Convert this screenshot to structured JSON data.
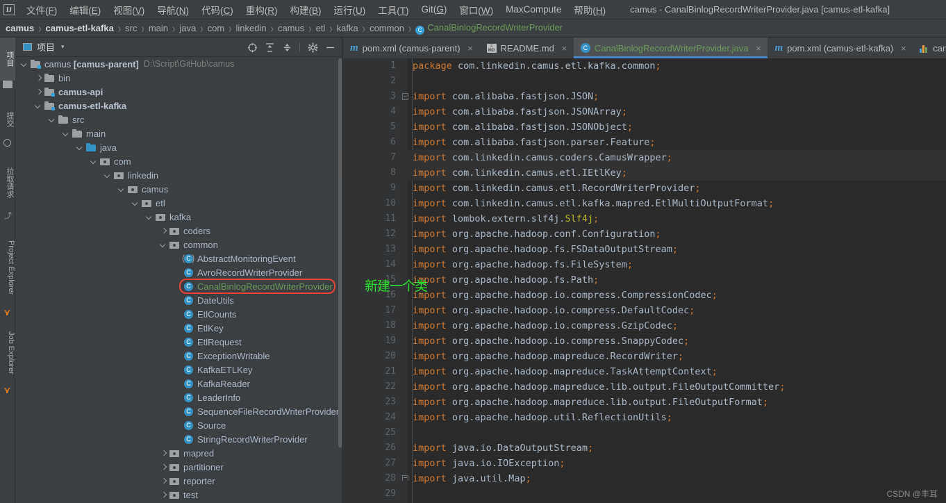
{
  "window": {
    "title": "camus - CanalBinlogRecordWriterProvider.java [camus-etl-kafka]",
    "logo": "IJ"
  },
  "menubar": {
    "items": [
      {
        "label": "文件(F)",
        "mnemonic": "F"
      },
      {
        "label": "编辑(E)",
        "mnemonic": "E"
      },
      {
        "label": "视图(V)",
        "mnemonic": "V"
      },
      {
        "label": "导航(N)",
        "mnemonic": "N"
      },
      {
        "label": "代码(C)",
        "mnemonic": "C"
      },
      {
        "label": "重构(R)",
        "mnemonic": "R"
      },
      {
        "label": "构建(B)",
        "mnemonic": "B"
      },
      {
        "label": "运行(U)",
        "mnemonic": "U"
      },
      {
        "label": "工具(T)",
        "mnemonic": "T"
      },
      {
        "label": "Git(G)",
        "mnemonic": "G"
      },
      {
        "label": "窗口(W)",
        "mnemonic": "W"
      },
      {
        "label": "MaxCompute",
        "mnemonic": ""
      },
      {
        "label": "帮助(H)",
        "mnemonic": "H"
      }
    ]
  },
  "breadcrumb": {
    "items": [
      {
        "label": "camus",
        "style": "bold"
      },
      {
        "label": "camus-etl-kafka",
        "style": "bold"
      },
      {
        "label": "src",
        "style": "normal"
      },
      {
        "label": "main",
        "style": "normal"
      },
      {
        "label": "java",
        "style": "normal"
      },
      {
        "label": "com",
        "style": "normal"
      },
      {
        "label": "linkedin",
        "style": "normal"
      },
      {
        "label": "camus",
        "style": "normal"
      },
      {
        "label": "etl",
        "style": "normal"
      },
      {
        "label": "kafka",
        "style": "normal"
      },
      {
        "label": "common",
        "style": "normal"
      }
    ],
    "current": "CanalBinlogRecordWriterProvider",
    "current_icon": "C",
    "separator": "›"
  },
  "toolstrip": {
    "items": [
      {
        "label": "项目",
        "icon": "project-icon",
        "active": true
      },
      {
        "label": "提交",
        "icon": "commit-icon",
        "active": false
      },
      {
        "label": "拉取请求",
        "icon": "pull-request-icon",
        "active": false
      },
      {
        "label": "Project Explorer",
        "icon": "maxcompute-icon",
        "active": false
      },
      {
        "label": "Job Explorer",
        "icon": "maxcompute-icon",
        "active": false
      }
    ]
  },
  "project_panel": {
    "title": "项目",
    "caret": "▾",
    "actions": [
      {
        "name": "select-opened-file",
        "glyph": "⊕"
      },
      {
        "name": "expand-all",
        "glyph": "⨍"
      },
      {
        "name": "collapse-all",
        "glyph": "⨌"
      },
      {
        "name": "settings",
        "glyph": "⚙"
      },
      {
        "name": "hide",
        "glyph": "—"
      }
    ],
    "tree": [
      {
        "indent": 0,
        "arrow": "down",
        "icon": "module-folder",
        "label": "camus [camus-parent]",
        "bold": true,
        "path": "D:\\Script\\GitHub\\camus"
      },
      {
        "indent": 1,
        "arrow": "right",
        "icon": "folder",
        "label": "bin",
        "bold": false,
        "path": ""
      },
      {
        "indent": 1,
        "arrow": "right",
        "icon": "module-folder",
        "label": "camus-api",
        "bold": true,
        "path": ""
      },
      {
        "indent": 1,
        "arrow": "down",
        "icon": "module-folder",
        "label": "camus-etl-kafka",
        "bold": true,
        "path": ""
      },
      {
        "indent": 2,
        "arrow": "down",
        "icon": "folder",
        "label": "src",
        "bold": false,
        "path": ""
      },
      {
        "indent": 3,
        "arrow": "down",
        "icon": "folder",
        "label": "main",
        "bold": false,
        "path": ""
      },
      {
        "indent": 4,
        "arrow": "down",
        "icon": "source-folder",
        "label": "java",
        "bold": false,
        "path": ""
      },
      {
        "indent": 5,
        "arrow": "down",
        "icon": "package",
        "label": "com",
        "bold": false,
        "path": ""
      },
      {
        "indent": 6,
        "arrow": "down",
        "icon": "package",
        "label": "linkedin",
        "bold": false,
        "path": ""
      },
      {
        "indent": 7,
        "arrow": "down",
        "icon": "package",
        "label": "camus",
        "bold": false,
        "path": ""
      },
      {
        "indent": 8,
        "arrow": "down",
        "icon": "package",
        "label": "etl",
        "bold": false,
        "path": ""
      },
      {
        "indent": 9,
        "arrow": "down",
        "icon": "package",
        "label": "kafka",
        "bold": false,
        "path": ""
      },
      {
        "indent": 10,
        "arrow": "right",
        "icon": "package",
        "label": "coders",
        "bold": false,
        "path": ""
      },
      {
        "indent": 10,
        "arrow": "down",
        "icon": "package",
        "label": "common",
        "bold": false,
        "path": ""
      },
      {
        "indent": 11,
        "arrow": "none",
        "icon": "interface",
        "label": "AbstractMonitoringEvent",
        "bold": false,
        "path": ""
      },
      {
        "indent": 11,
        "arrow": "none",
        "icon": "class",
        "label": "AvroRecordWriterProvider",
        "bold": false,
        "path": ""
      },
      {
        "indent": 11,
        "arrow": "none",
        "icon": "class",
        "label": "CanalBinlogRecordWriterProvider",
        "bold": false,
        "path": "",
        "highlighted": true
      },
      {
        "indent": 11,
        "arrow": "none",
        "icon": "class",
        "label": "DateUtils",
        "bold": false,
        "path": ""
      },
      {
        "indent": 11,
        "arrow": "none",
        "icon": "class",
        "label": "EtlCounts",
        "bold": false,
        "path": ""
      },
      {
        "indent": 11,
        "arrow": "none",
        "icon": "class",
        "label": "EtlKey",
        "bold": false,
        "path": ""
      },
      {
        "indent": 11,
        "arrow": "none",
        "icon": "class",
        "label": "EtlRequest",
        "bold": false,
        "path": ""
      },
      {
        "indent": 11,
        "arrow": "none",
        "icon": "class",
        "label": "ExceptionWritable",
        "bold": false,
        "path": ""
      },
      {
        "indent": 11,
        "arrow": "none",
        "icon": "class",
        "label": "KafkaETLKey",
        "bold": false,
        "path": ""
      },
      {
        "indent": 11,
        "arrow": "none",
        "icon": "class",
        "label": "KafkaReader",
        "bold": false,
        "path": ""
      },
      {
        "indent": 11,
        "arrow": "none",
        "icon": "class",
        "label": "LeaderInfo",
        "bold": false,
        "path": ""
      },
      {
        "indent": 11,
        "arrow": "none",
        "icon": "class",
        "label": "SequenceFileRecordWriterProvider",
        "bold": false,
        "path": ""
      },
      {
        "indent": 11,
        "arrow": "none",
        "icon": "class",
        "label": "Source",
        "bold": false,
        "path": ""
      },
      {
        "indent": 11,
        "arrow": "none",
        "icon": "class",
        "label": "StringRecordWriterProvider",
        "bold": false,
        "path": ""
      },
      {
        "indent": 10,
        "arrow": "right",
        "icon": "package",
        "label": "mapred",
        "bold": false,
        "path": ""
      },
      {
        "indent": 10,
        "arrow": "right",
        "icon": "package",
        "label": "partitioner",
        "bold": false,
        "path": ""
      },
      {
        "indent": 10,
        "arrow": "right",
        "icon": "package",
        "label": "reporter",
        "bold": false,
        "path": ""
      },
      {
        "indent": 10,
        "arrow": "right",
        "icon": "package",
        "label": "test",
        "bold": false,
        "path": ""
      }
    ]
  },
  "editor": {
    "tabs": [
      {
        "label": "pom.xml (camus-parent)",
        "icon": "maven-icon",
        "active": false,
        "close": "×"
      },
      {
        "label": "README.md",
        "icon": "markdown-icon",
        "active": false,
        "close": "×"
      },
      {
        "label": "CanalBinlogRecordWriterProvider.java",
        "icon": "class-icon",
        "active": true,
        "close": "×"
      },
      {
        "label": "pom.xml (camus-etl-kafka)",
        "icon": "maven-icon",
        "active": false,
        "close": "×"
      },
      {
        "label": "camus.",
        "icon": "chart-icon",
        "active": false,
        "close": ""
      }
    ],
    "lines": [
      {
        "n": 1,
        "kw": "package",
        "rest": " com.linkedin.camus.etl.kafka.common;",
        "fold": "",
        "hl": false
      },
      {
        "n": 2,
        "kw": "",
        "rest": "",
        "fold": "",
        "hl": false
      },
      {
        "n": 3,
        "kw": "import",
        "rest": " com.alibaba.fastjson.JSON;",
        "fold": "start",
        "hl": false
      },
      {
        "n": 4,
        "kw": "import",
        "rest": " com.alibaba.fastjson.JSONArray;",
        "fold": "",
        "hl": false
      },
      {
        "n": 5,
        "kw": "import",
        "rest": " com.alibaba.fastjson.JSONObject;",
        "fold": "",
        "hl": false
      },
      {
        "n": 6,
        "kw": "import",
        "rest": " com.alibaba.fastjson.parser.Feature;",
        "fold": "",
        "hl": false
      },
      {
        "n": 7,
        "kw": "import",
        "rest": " com.linkedin.camus.coders.CamusWrapper;",
        "fold": "",
        "hl": true
      },
      {
        "n": 8,
        "kw": "import",
        "rest": " com.linkedin.camus.etl.IEtlKey;",
        "fold": "",
        "hl": true
      },
      {
        "n": 9,
        "kw": "import",
        "rest": " com.linkedin.camus.etl.RecordWriterProvider;",
        "fold": "",
        "hl": false
      },
      {
        "n": 10,
        "kw": "import",
        "rest": " com.linkedin.camus.etl.kafka.mapred.EtlMultiOutputFormat;",
        "fold": "",
        "hl": false
      },
      {
        "n": 11,
        "kw": "import",
        "rest": " lombok.extern.slf4j.",
        "annotation": "Slf4j",
        "tail": ";",
        "fold": "",
        "hl": false
      },
      {
        "n": 12,
        "kw": "import",
        "rest": " org.apache.hadoop.conf.Configuration;",
        "fold": "",
        "hl": false
      },
      {
        "n": 13,
        "kw": "import",
        "rest": " org.apache.hadoop.fs.FSDataOutputStream;",
        "fold": "",
        "hl": false
      },
      {
        "n": 14,
        "kw": "import",
        "rest": " org.apache.hadoop.fs.FileSystem;",
        "fold": "",
        "hl": false
      },
      {
        "n": 15,
        "kw": "import",
        "rest": " org.apache.hadoop.fs.Path;",
        "fold": "",
        "hl": false
      },
      {
        "n": 16,
        "kw": "import",
        "rest": " org.apache.hadoop.io.compress.CompressionCodec;",
        "fold": "",
        "hl": false
      },
      {
        "n": 17,
        "kw": "import",
        "rest": " org.apache.hadoop.io.compress.DefaultCodec;",
        "fold": "",
        "hl": false
      },
      {
        "n": 18,
        "kw": "import",
        "rest": " org.apache.hadoop.io.compress.GzipCodec;",
        "fold": "",
        "hl": false
      },
      {
        "n": 19,
        "kw": "import",
        "rest": " org.apache.hadoop.io.compress.SnappyCodec;",
        "fold": "",
        "hl": false
      },
      {
        "n": 20,
        "kw": "import",
        "rest": " org.apache.hadoop.mapreduce.RecordWriter;",
        "fold": "",
        "hl": false
      },
      {
        "n": 21,
        "kw": "import",
        "rest": " org.apache.hadoop.mapreduce.TaskAttemptContext;",
        "fold": "",
        "hl": false
      },
      {
        "n": 22,
        "kw": "import",
        "rest": " org.apache.hadoop.mapreduce.lib.output.FileOutputCommitter;",
        "fold": "",
        "hl": false
      },
      {
        "n": 23,
        "kw": "import",
        "rest": " org.apache.hadoop.mapreduce.lib.output.FileOutputFormat;",
        "fold": "",
        "hl": false
      },
      {
        "n": 24,
        "kw": "import",
        "rest": " org.apache.hadoop.util.ReflectionUtils;",
        "fold": "",
        "hl": false
      },
      {
        "n": 25,
        "kw": "",
        "rest": "",
        "fold": "",
        "hl": false
      },
      {
        "n": 26,
        "kw": "import",
        "rest": " java.io.DataOutputStream;",
        "fold": "",
        "hl": false
      },
      {
        "n": 27,
        "kw": "import",
        "rest": " java.io.IOException;",
        "fold": "",
        "hl": false
      },
      {
        "n": 28,
        "kw": "import",
        "rest": " java.util.Map;",
        "fold": "end",
        "hl": false
      },
      {
        "n": 29,
        "kw": "",
        "rest": "",
        "fold": "",
        "hl": false
      }
    ]
  },
  "annotation": {
    "text": "新建一个类",
    "color": "#2ee02e"
  },
  "watermark": {
    "text": "CSDN @丰耳"
  },
  "colors": {
    "background": "#3c3f41",
    "editor_bg": "#2b2b2b",
    "gutter_bg": "#313335",
    "accent_blue": "#3592c4",
    "keyword_orange": "#cc7832",
    "text": "#a9b7c6",
    "selected_green": "#6a9a5b",
    "highlight_red": "#e8423a"
  }
}
